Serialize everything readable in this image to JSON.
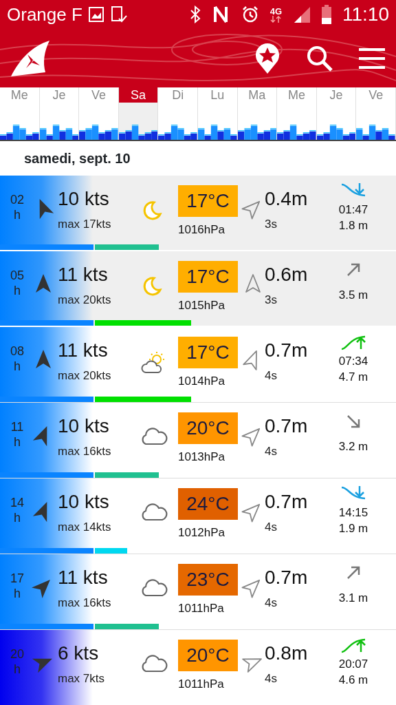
{
  "status_bar": {
    "carrier": "Orange F",
    "network": "4G",
    "time": "11:10"
  },
  "days": [
    {
      "label": "Me",
      "selected": false
    },
    {
      "label": "Je",
      "selected": false
    },
    {
      "label": "Ve",
      "selected": false
    },
    {
      "label": "Sa",
      "selected": true
    },
    {
      "label": "Di",
      "selected": false
    },
    {
      "label": "Lu",
      "selected": false
    },
    {
      "label": "Ma",
      "selected": false
    },
    {
      "label": "Me",
      "selected": false
    },
    {
      "label": "Je",
      "selected": false
    },
    {
      "label": "Ve",
      "selected": false
    }
  ],
  "date_heading": "samedi, sept. 10",
  "rows": [
    {
      "hour": "02",
      "unit": "h",
      "shaded": true,
      "color": "#0080ff",
      "wind_arrow": {
        "kind": "nnw"
      },
      "wind": "10 kts",
      "gust": "max 17kts",
      "weather": {
        "kind": "moon"
      },
      "temperature": {
        "text": "17°C",
        "color": "#ffae00"
      },
      "pressure": "1016hPa",
      "swell_arrow": {
        "kind": "ne"
      },
      "swell": "0.4m",
      "period": "3s",
      "tide": {
        "kind": "low",
        "time": "01:47",
        "height": "1.8 m"
      },
      "gust_bar": {
        "kind": "medium",
        "color": "#20c090"
      }
    },
    {
      "hour": "05",
      "unit": "h",
      "shaded": true,
      "color": "#0080ff",
      "wind_arrow": {
        "kind": "n"
      },
      "wind": "11 kts",
      "gust": "max 20kts",
      "weather": {
        "kind": "moon"
      },
      "temperature": {
        "text": "17°C",
        "color": "#ffae00"
      },
      "pressure": "1015hPa",
      "swell_arrow": {
        "kind": "n"
      },
      "swell": "0.6m",
      "period": "3s",
      "tide": {
        "kind": "rising",
        "height": "3.5 m"
      },
      "gust_bar": {
        "kind": "long",
        "color": "#00e000"
      }
    },
    {
      "hour": "08",
      "unit": "h",
      "shaded": false,
      "color": "#0080ff",
      "wind_arrow": {
        "kind": "n"
      },
      "wind": "11 kts",
      "gust": "max 20kts",
      "weather": {
        "kind": "sun-cloud"
      },
      "temperature": {
        "text": "17°C",
        "color": "#ffae00"
      },
      "pressure": "1014hPa",
      "swell_arrow": {
        "kind": "nne"
      },
      "swell": "0.7m",
      "period": "4s",
      "tide": {
        "kind": "high",
        "time": "07:34",
        "height": "4.7 m"
      },
      "gust_bar": {
        "kind": "long",
        "color": "#00e000"
      }
    },
    {
      "hour": "11",
      "unit": "h",
      "shaded": false,
      "color": "#0080ff",
      "wind_arrow": {
        "kind": "nne"
      },
      "wind": "10 kts",
      "gust": "max 16kts",
      "weather": {
        "kind": "cloud"
      },
      "temperature": {
        "text": "20°C",
        "color": "#ff9500"
      },
      "pressure": "1013hPa",
      "swell_arrow": {
        "kind": "ne"
      },
      "swell": "0.7m",
      "period": "4s",
      "tide": {
        "kind": "falling",
        "height": "3.2 m"
      },
      "gust_bar": {
        "kind": "medium",
        "color": "#20c090"
      }
    },
    {
      "hour": "14",
      "unit": "h",
      "shaded": false,
      "color": "#0080ff",
      "wind_arrow": {
        "kind": "nne"
      },
      "wind": "10 kts",
      "gust": "max 14kts",
      "weather": {
        "kind": "cloud"
      },
      "temperature": {
        "text": "24°C",
        "color": "#e06000"
      },
      "pressure": "1012hPa",
      "swell_arrow": {
        "kind": "ne"
      },
      "swell": "0.7m",
      "period": "4s",
      "tide": {
        "kind": "low",
        "time": "14:15",
        "height": "1.9 m"
      },
      "gust_bar": {
        "kind": "short",
        "color": "#00d8f0"
      }
    },
    {
      "hour": "17",
      "unit": "h",
      "shaded": false,
      "color": "#0080ff",
      "wind_arrow": {
        "kind": "ne"
      },
      "wind": "11 kts",
      "gust": "max 16kts",
      "weather": {
        "kind": "cloud"
      },
      "temperature": {
        "text": "23°C",
        "color": "#e56800"
      },
      "pressure": "1011hPa",
      "swell_arrow": {
        "kind": "ne"
      },
      "swell": "0.7m",
      "period": "4s",
      "tide": {
        "kind": "rising",
        "height": "3.1 m"
      },
      "gust_bar": {
        "kind": "medium",
        "color": "#20c090"
      }
    },
    {
      "hour": "20",
      "unit": "h",
      "shaded": false,
      "color": "#0000ee",
      "wind_arrow": {
        "kind": "ene"
      },
      "wind": "6 kts",
      "gust": "max 7kts",
      "weather": {
        "kind": "cloud"
      },
      "temperature": {
        "text": "20°C",
        "color": "#ff9500"
      },
      "pressure": "1011hPa",
      "swell_arrow": {
        "kind": "ene"
      },
      "swell": "0.8m",
      "period": "4s",
      "tide": {
        "kind": "high",
        "time": "20:07",
        "height": "4.6 m"
      }
    }
  ]
}
